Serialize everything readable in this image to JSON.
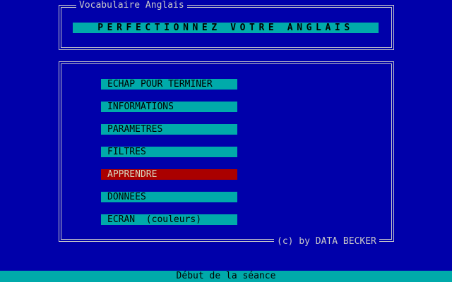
{
  "app": {
    "title": "Vocabulaire Anglais"
  },
  "header": {
    "headline": "PERFECTIONNEZ VOTRE ANGLAIS"
  },
  "menu": {
    "items": [
      {
        "label": "ECHAP POUR TERMINER",
        "selected": false
      },
      {
        "label": "INFORMATIONS",
        "selected": false
      },
      {
        "label": "PARAMETRES",
        "selected": false
      },
      {
        "label": "FILTRES",
        "selected": false
      },
      {
        "label": "APPRENDRE",
        "selected": true
      },
      {
        "label": "DONNEES",
        "selected": false
      },
      {
        "label": "ECRAN  (couleurs)",
        "selected": false
      }
    ]
  },
  "footer": {
    "copyright": "(c) by DATA BECKER",
    "status": "Début de la séance"
  },
  "colors": {
    "background": "#0000aa",
    "menu_item": "#00aaaa",
    "selected_item": "#aa0000",
    "frame": "#c8c8c8"
  }
}
